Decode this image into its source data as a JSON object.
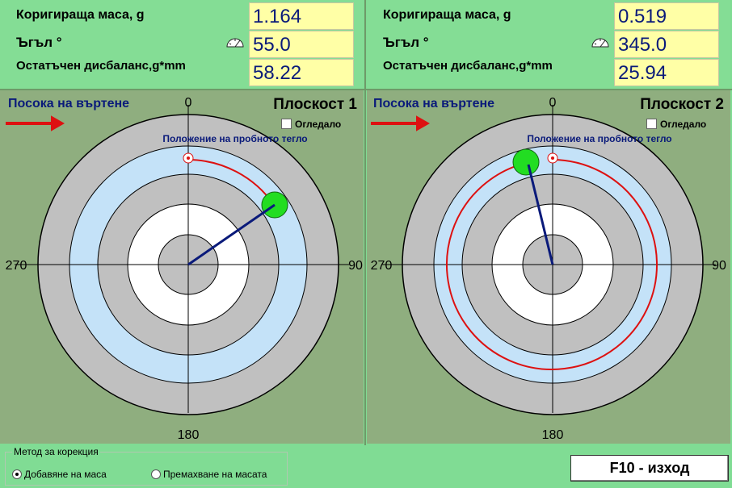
{
  "planes": [
    {
      "mass_label": "Коригираща маса, g",
      "angle_label": "Ъгъл  °",
      "residual_label": "Остатъчен дисбаланс,g*mm",
      "mass_value": "1.164",
      "angle_value": "55.0",
      "residual_value": "58.22",
      "rotation_label": "Посока на въртене",
      "plane_title": "Плоскост 1",
      "mirror_label": "Огледало",
      "trial_label": "Положение на пробното тегло",
      "axis_top": "0",
      "axis_right": "90",
      "axis_bottom": "180",
      "axis_left": "270"
    },
    {
      "mass_label": "Коригираща маса, g",
      "angle_label": "Ъгъл  °",
      "residual_label": "Остатъчен дисбаланс,g*mm",
      "mass_value": "0.519",
      "angle_value": "345.0",
      "residual_value": "25.94",
      "rotation_label": "Посока на въртене",
      "plane_title": "Плоскост 2",
      "mirror_label": "Огледало",
      "trial_label": "Положение на пробното тегло",
      "axis_top": "0",
      "axis_right": "90",
      "axis_bottom": "180",
      "axis_left": "270"
    }
  ],
  "correction": {
    "title": "Метод за корекция",
    "add_label": "Добавяне на маса",
    "remove_label": "Премахване на масата",
    "selected": "add"
  },
  "exit_button": "F10 - изход",
  "colors": {
    "panel_bg": "#84dd95",
    "value_bg": "#ffffa6",
    "value_text": "#0a1a7a",
    "plot_bg": "#8fae7f",
    "ring_gray": "#c0c0c0",
    "ring_blue": "#c4e2f8",
    "ring_white": "#ffffff",
    "arrow_red": "#dd1111",
    "vector_blue": "#0a1a7a",
    "weight_green": "#22dd22"
  }
}
